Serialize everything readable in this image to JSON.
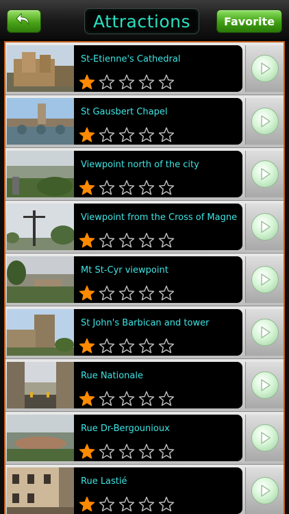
{
  "header": {
    "title": "Attractions",
    "favorite_label": "Favorite"
  },
  "colors": {
    "accent_green": "#3fa012",
    "title_text": "#27e0c0",
    "list_border": "#c8611d",
    "row_title": "#3fe4e4",
    "star_filled": "#ff8a00"
  },
  "icons": {
    "back": "back-arrow-icon",
    "go": "play-arrow-icon",
    "star_filled": "star-filled-icon",
    "star_empty": "star-outline-icon"
  },
  "attractions": [
    {
      "name": "St-Etienne's Cathedral",
      "rating": 1,
      "max_rating": 5
    },
    {
      "name": "St Gausbert Chapel",
      "rating": 1,
      "max_rating": 5
    },
    {
      "name": "Viewpoint north of the city",
      "rating": 1,
      "max_rating": 5
    },
    {
      "name": "Viewpoint from the Cross of Magne",
      "rating": 1,
      "max_rating": 5
    },
    {
      "name": "Mt St-Cyr viewpoint",
      "rating": 1,
      "max_rating": 5
    },
    {
      "name": "St John's Barbican and tower",
      "rating": 1,
      "max_rating": 5
    },
    {
      "name": "Rue Nationale",
      "rating": 1,
      "max_rating": 5
    },
    {
      "name": "Rue Dr-Bergounioux",
      "rating": 1,
      "max_rating": 5
    },
    {
      "name": "Rue Lastié",
      "rating": 1,
      "max_rating": 5
    }
  ]
}
